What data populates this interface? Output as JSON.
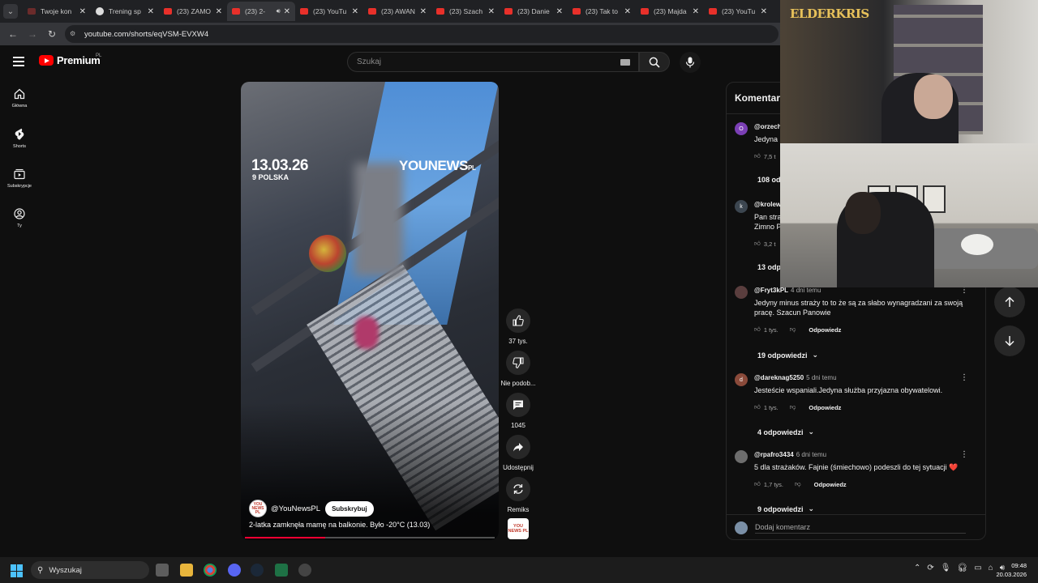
{
  "browser": {
    "tabs": [
      {
        "label": "Twoje kon",
        "icon": "youtube-studio-icon"
      },
      {
        "label": "Trening sp",
        "icon": "soccer-ball-icon"
      },
      {
        "label": "(23) ZAMO",
        "icon": "youtube-icon"
      },
      {
        "label": "(23) 2-",
        "icon": "youtube-icon",
        "active": true
      },
      {
        "label": "(23) YouTu",
        "icon": "youtube-icon"
      },
      {
        "label": "(23) AWAN",
        "icon": "youtube-icon"
      },
      {
        "label": "(23) Szach",
        "icon": "youtube-icon"
      },
      {
        "label": "(23) Danie",
        "icon": "youtube-icon"
      },
      {
        "label": "(23) Tak to",
        "icon": "youtube-icon"
      },
      {
        "label": "(23) Majda",
        "icon": "youtube-icon"
      },
      {
        "label": "(23) YouTu",
        "icon": "youtube-icon"
      }
    ],
    "url": "youtube.com/shorts/eqVSM-EVXW4"
  },
  "masthead": {
    "logo_text": "Premium",
    "region": "PL",
    "search_placeholder": "Szukaj"
  },
  "sidebar": {
    "items": [
      {
        "label": "Główna",
        "icon": "home-icon"
      },
      {
        "label": "Shorts",
        "icon": "shorts-icon"
      },
      {
        "label": "Subskrypcje",
        "icon": "subscriptions-icon"
      },
      {
        "label": "Ty",
        "icon": "user-circle-icon"
      }
    ]
  },
  "short": {
    "overlay_date": "13.03.26",
    "overlay_location": "9 POLSKA",
    "overlay_brand": "YOUNEWS",
    "overlay_brand_suffix": "PL",
    "channel_avatar_text": "YOU NEWS PL",
    "channel_name": "@YouNewsPL",
    "subscribe_label": "Subskrybuj",
    "caption": "2-latka zamknęła mamę na balkonie. Było -20°C (13.03)",
    "progress": 0.32
  },
  "actions": {
    "like_count": "37 tys.",
    "dislike_label": "Nie podob...",
    "comment_count": "1045",
    "share_label": "Udostępnij",
    "remix_label": "Remiks"
  },
  "comments": {
    "title": "Komentarze",
    "add_placeholder": "Dodaj komentarz",
    "items": [
      {
        "avatar": "O",
        "avatar_color": "#7b3fb5",
        "user": "@orzech",
        "time": "",
        "text": "Jedyna",
        "likes": "7,5 t",
        "replies": "108 od"
      },
      {
        "avatar": "k",
        "avatar_color": "#3c4650",
        "user": "@krolew",
        "time": "",
        "text": "Pan stra\nZimno P",
        "likes": "3,2 t",
        "replies": "13 odp"
      },
      {
        "avatar": "",
        "avatar_color": "#5a3e3e",
        "user": "@Fryt3kPL",
        "time": "4 dni temu",
        "text": "Jedyny minus straży to to że  są za słabo wynagradzani za swoją pracę. Szacun Panowie",
        "likes": "1 tys.",
        "replies": "19 odpowiedzi"
      },
      {
        "avatar": "d",
        "avatar_color": "#8a4a3a",
        "user": "@dareknag5250",
        "time": "5 dni temu",
        "text": "Jesteście wspaniali.Jedyna służba przyjazna obywatelowi.",
        "likes": "1 tys.",
        "replies": "4 odpowiedzi"
      },
      {
        "avatar": "",
        "avatar_color": "#6d6d6d",
        "user": "@rpafro3434",
        "time": "6 dni temu",
        "text": "5 dla strażaków. Fajnie (śmiechowo) podeszli do tej sytuacji ❤️",
        "likes": "1,7 tys.",
        "replies": "9 odpowiedzi"
      }
    ],
    "reply_label": "Odpowiedz"
  },
  "webcam": {
    "logo_text": "ELDERKRIS"
  },
  "taskbar": {
    "search_label": "Wyszukaj",
    "time": "09:48",
    "date": "20.03.2026"
  }
}
